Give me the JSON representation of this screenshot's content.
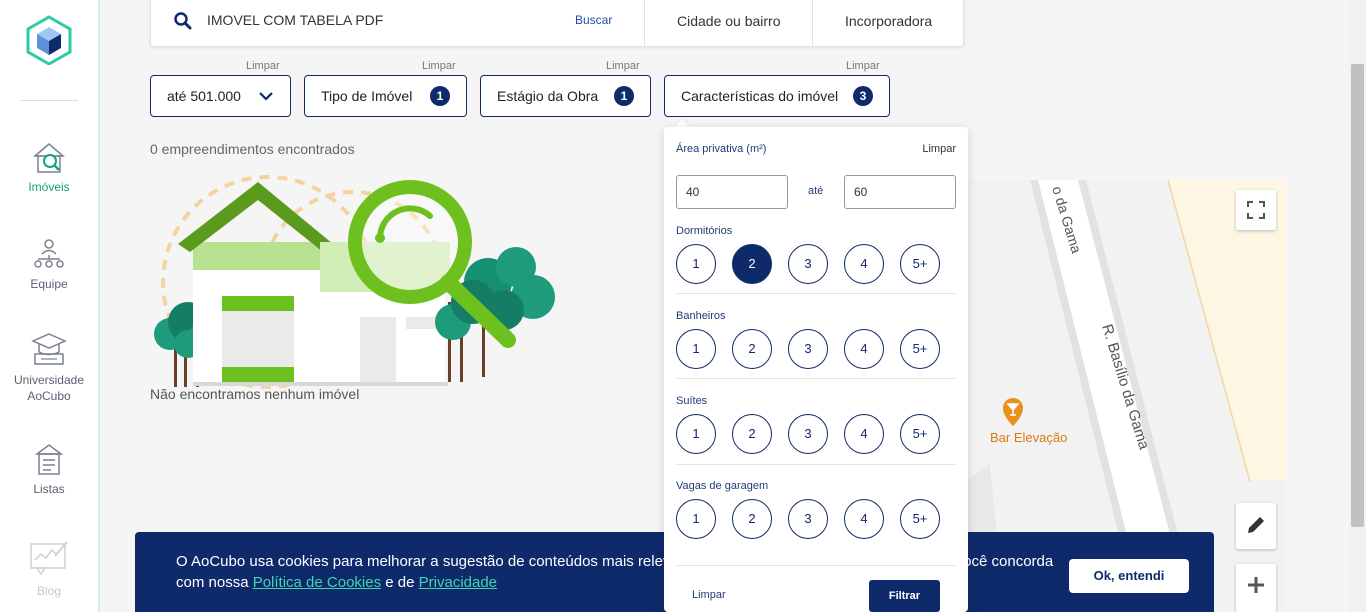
{
  "sidebar": {
    "items": [
      {
        "label": "Imóveis"
      },
      {
        "label": "Equipe"
      },
      {
        "label": "Universidade AoCubo"
      },
      {
        "label": "Listas"
      },
      {
        "label": "Blog"
      }
    ]
  },
  "search": {
    "value": "IMOVEL COM TABELA PDF",
    "button_label": "Buscar",
    "tabs": [
      "Cidade ou bairro",
      "Incorporadora"
    ]
  },
  "filters": {
    "clear_label": "Limpar",
    "price": "até 501.000",
    "type": {
      "label": "Tipo de Imóvel",
      "count": "1"
    },
    "stage": {
      "label": "Estágio da Obra",
      "count": "1"
    },
    "features": {
      "label": "Características do imóvel",
      "count": "3"
    }
  },
  "results": {
    "count_text": "0 empreendimentos encontrados",
    "empty_text": "Não encontramos nenhum imóvel"
  },
  "map": {
    "streets": [
      "o da Gama",
      "R. Basílio da Gama"
    ],
    "poi": "Bar Elevação"
  },
  "panel": {
    "area_label": "Área privativa (m²)",
    "clear_label": "Limpar",
    "area_min": "40",
    "area_max": "60",
    "ate_label": "até",
    "options": [
      "1",
      "2",
      "3",
      "4",
      "5+"
    ],
    "sections": [
      {
        "label": "Dormitórios",
        "selected": "2"
      },
      {
        "label": "Banheiros",
        "selected": ""
      },
      {
        "label": "Suítes",
        "selected": ""
      },
      {
        "label": "Vagas de garagem",
        "selected": ""
      }
    ],
    "footer_clear": "Limpar",
    "filter_button": "Filtrar"
  },
  "cookie": {
    "text_before": "O AoCubo usa cookies para melhorar a sugestão de conteúdos mais relevantes para você. Ao continuar navegando, você concorda com nossa ",
    "link_cookies": "Política de Cookies",
    "text_middle": " e de ",
    "link_privacy": "Privacidade",
    "button": "Ok, entendi"
  },
  "colors": {
    "primary": "#0f2a6b",
    "accent_green": "#12a37a",
    "link_teal": "#3dd6b0",
    "poi_orange": "#e8921c"
  }
}
